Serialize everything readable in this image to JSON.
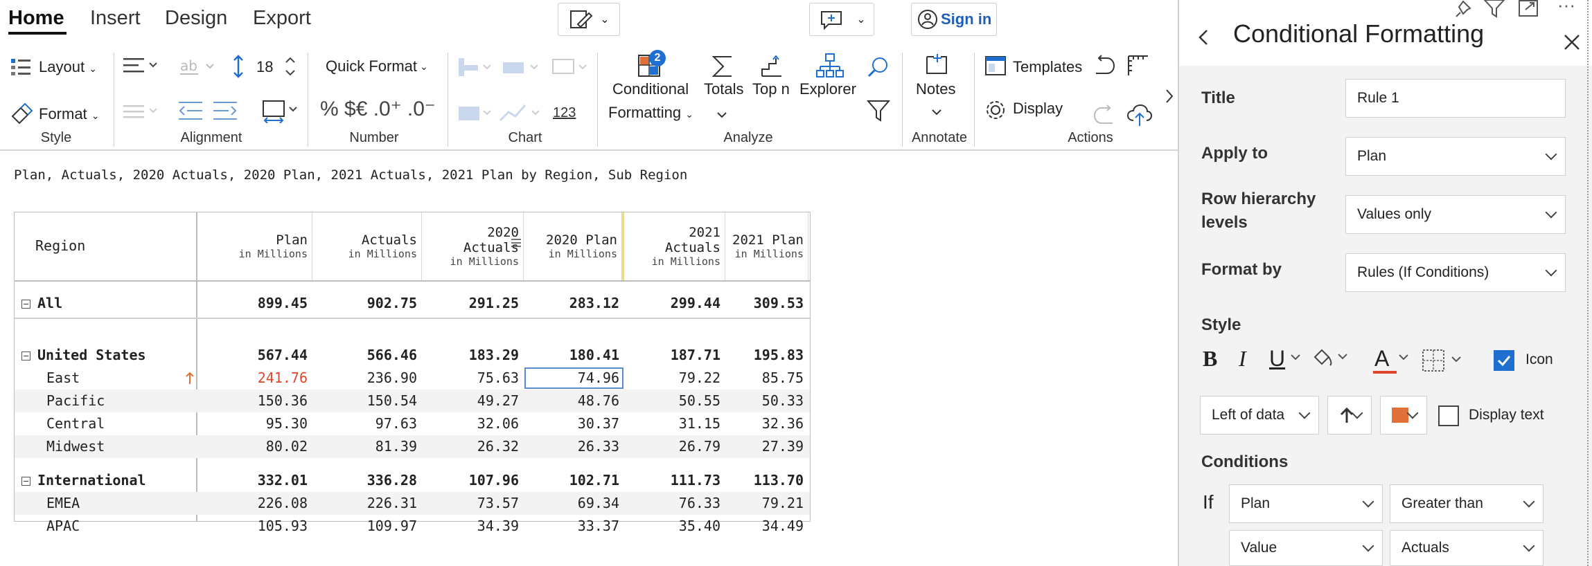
{
  "tabs": [
    "Home",
    "Insert",
    "Design",
    "Export"
  ],
  "sign_in": "Sign in",
  "ribbon": {
    "layout_label": "Layout",
    "format_label": "Format",
    "style_group": "Style",
    "font_size": "18",
    "alignment_group": "Alignment",
    "quick_format": "Quick Format",
    "number_symbols": "% $€ .0⁺ .0⁻",
    "number_group": "Number",
    "chart_number": "123",
    "chart_group": "Chart",
    "conditional_line1": "Conditional",
    "conditional_line2": "Formatting",
    "conditional_badge": "2",
    "totals": "Totals",
    "topn": "Top n",
    "explorer": "Explorer",
    "analyze_group": "Analyze",
    "notes": "Notes",
    "annotate_group": "Annotate",
    "templates": "Templates",
    "display": "Display",
    "actions_group": "Actions"
  },
  "report": {
    "subtitle": "Plan, Actuals, 2020 Actuals, 2020 Plan, 2021 Actuals, 2021 Plan by Region, Sub Region",
    "region_header": "Region",
    "columns": [
      {
        "line1": "",
        "line2": "Plan",
        "unit": "in Millions"
      },
      {
        "line1": "",
        "line2": "Actuals",
        "unit": "in Millions"
      },
      {
        "line1": "2020",
        "line2": "Actuals",
        "unit": "in Millions"
      },
      {
        "line1": "",
        "line2": "2020 Plan",
        "unit": "in Millions"
      },
      {
        "line1": "2021",
        "line2": "Actuals",
        "unit": "in Millions"
      },
      {
        "line1": "",
        "line2": "2021 Plan",
        "unit": "in Millions"
      }
    ],
    "rows": [
      {
        "label": "All",
        "values": [
          "899.45",
          "902.75",
          "291.25",
          "283.12",
          "299.44",
          "309.53"
        ]
      },
      {
        "label": "United States",
        "values": [
          "567.44",
          "566.46",
          "183.29",
          "180.41",
          "187.71",
          "195.83"
        ]
      },
      {
        "label": "East",
        "values": [
          "241.76",
          "236.90",
          "75.63",
          "74.96",
          "79.22",
          "85.75"
        ]
      },
      {
        "label": "Pacific",
        "values": [
          "150.36",
          "150.54",
          "49.27",
          "48.76",
          "50.55",
          "50.33"
        ]
      },
      {
        "label": "Central",
        "values": [
          "95.30",
          "97.63",
          "32.06",
          "30.37",
          "31.15",
          "32.36"
        ]
      },
      {
        "label": "Midwest",
        "values": [
          "80.02",
          "81.39",
          "26.32",
          "26.33",
          "26.79",
          "27.39"
        ]
      },
      {
        "label": "International",
        "values": [
          "332.01",
          "336.28",
          "107.96",
          "102.71",
          "111.73",
          "113.70"
        ]
      },
      {
        "label": "EMEA",
        "values": [
          "226.08",
          "226.31",
          "73.57",
          "69.34",
          "76.33",
          "79.21"
        ]
      },
      {
        "label": "APAC",
        "values": [
          "105.93",
          "109.97",
          "34.39",
          "33.37",
          "35.40",
          "34.49"
        ]
      }
    ],
    "highlight_color": "#e0452b",
    "arrow_color": "#e07030"
  },
  "panel": {
    "title": "Conditional Formatting",
    "title_label": "Title",
    "title_value": "Rule 1",
    "apply_label": "Apply to",
    "apply_value": "Plan",
    "row_levels_line1": "Row hierarchy",
    "row_levels_line2": "levels",
    "row_levels_value": "Values only",
    "format_by_label": "Format by",
    "format_by_value": "Rules (If Conditions)",
    "style_label": "Style",
    "bold": "B",
    "italic": "I",
    "underline": "U",
    "font_color_letter": "A",
    "icon_label": "Icon",
    "icon_position": "Left of data",
    "display_text_label": "Display text",
    "icon_swatch_color": "#e07038",
    "conditions_label": "Conditions",
    "if_label": "If",
    "cond_field": "Plan",
    "cond_operator": "Greater than",
    "cond_value_type": "Value",
    "cond_compare": "Actuals"
  }
}
